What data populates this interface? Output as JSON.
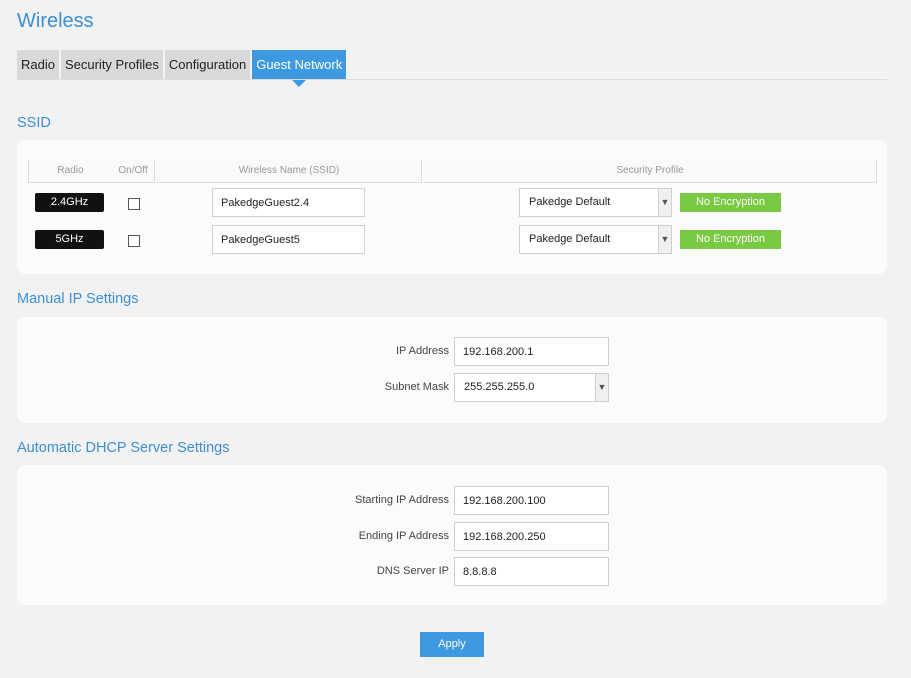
{
  "page": {
    "title": "Wireless"
  },
  "tabs": [
    {
      "label": "Radio"
    },
    {
      "label": "Security Profiles"
    },
    {
      "label": "Configuration"
    },
    {
      "label": "Guest Network",
      "active": true
    }
  ],
  "ssid": {
    "title": "SSID",
    "headers": {
      "radio": "Radio",
      "onoff": "On/Off",
      "name": "Wireless Name (SSID)",
      "profile": "Security Profile"
    },
    "rows": [
      {
        "radio": "2.4GHz",
        "enabled": false,
        "name": "PakedgeGuest2.4",
        "profile": "Pakedge Default",
        "encryption": "No Encryption"
      },
      {
        "radio": "5GHz",
        "enabled": false,
        "name": "PakedgeGuest5",
        "profile": "Pakedge Default",
        "encryption": "No Encryption"
      }
    ]
  },
  "manual_ip": {
    "title": "Manual IP Settings",
    "ip_label": "IP Address",
    "ip_value": "192.168.200.1",
    "mask_label": "Subnet Mask",
    "mask_value": "255.255.255.0"
  },
  "dhcp": {
    "title": "Automatic DHCP Server Settings",
    "start_label": "Starting IP Address",
    "start_value": "192.168.200.100",
    "end_label": "Ending IP Address",
    "end_value": "192.168.200.250",
    "dns_label": "DNS Server IP",
    "dns_value": "8.8.8.8"
  },
  "apply_label": "Apply",
  "colors": {
    "accent": "#3d9ae0",
    "encryption": "#7ac943",
    "radio_badge": "#111111"
  }
}
